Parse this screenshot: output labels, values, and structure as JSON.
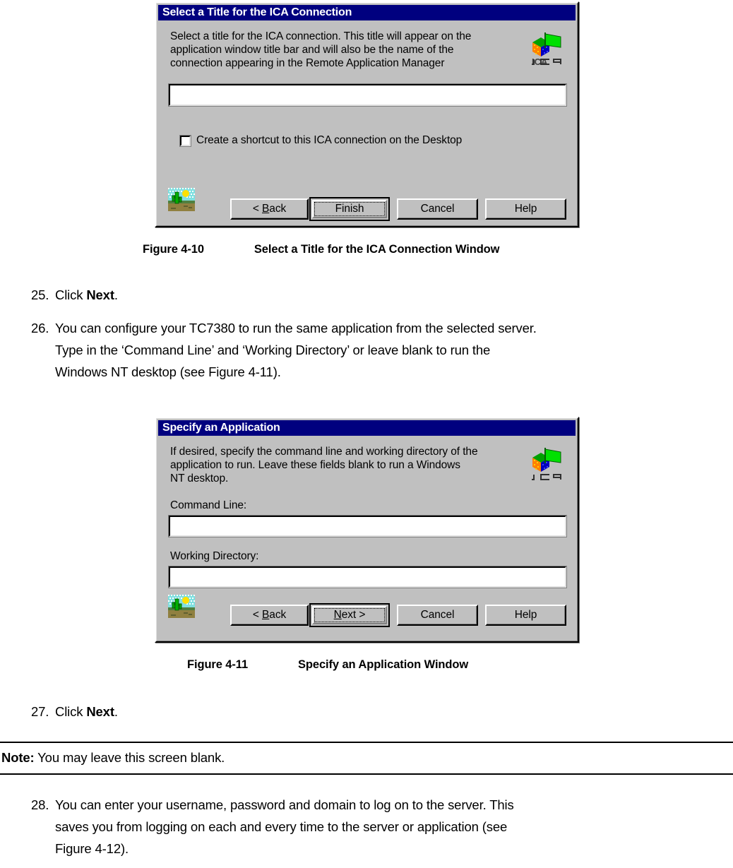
{
  "page": {
    "background": "#ffffff",
    "text_color": "#000000"
  },
  "dialog1": {
    "title": "Select a Title for the ICA Connection",
    "instruction": "Select a title for the ICA connection.  This title will appear on the\napplication window title bar and will also be the name of the\nconnection appearing in the Remote Application Manager",
    "title_input": {
      "value": "",
      "placeholder": ""
    },
    "checkbox": {
      "label": "Create a shortcut to this ICA connection on the Desktop",
      "checked": false
    },
    "buttons": {
      "back": "< Back",
      "finish": "Finish",
      "cancel": "Cancel",
      "help": "Help",
      "default_button": "Finish"
    },
    "titlebar_color": "#00007f",
    "face_color": "#c0c0c0",
    "icons": {
      "logo": "ica-logo-icon",
      "logo_text": "ICA",
      "wizard": "cactus-desert-icon"
    }
  },
  "figure1": {
    "number": "Figure 4-10",
    "caption": "Select a Title for the ICA Connection Window"
  },
  "steps_upper": [
    {
      "number": "25.",
      "text_before": "Click ",
      "text_bold": "Next",
      "text_after": "."
    },
    {
      "number": "26.",
      "text": "You can configure your TC7380 to run the same application from the selected server.\nType in the ‘Command Line’ and ‘Working Directory’ or leave blank to run the\nWindows NT desktop (see Figure 4-11)."
    }
  ],
  "dialog2": {
    "title": "Specify an Application",
    "instruction": "If desired, specify the command line and working directory of the\napplication to run.  Leave these fields blank to run a Windows\nNT desktop.",
    "command_line": {
      "label": "Command Line:",
      "value": "",
      "placeholder": ""
    },
    "working_directory": {
      "label": "Working Directory:",
      "value": "",
      "placeholder": ""
    },
    "buttons": {
      "back": "< Back",
      "next": "Next >",
      "cancel": "Cancel",
      "help": "Help",
      "default_button": "Next >"
    },
    "titlebar_color": "#00007f",
    "face_color": "#c0c0c0",
    "icons": {
      "logo": "ica-logo-icon",
      "logo_text": "ICA",
      "wizard": "cactus-desert-icon"
    }
  },
  "figure2": {
    "number": "Figure 4-11",
    "caption": "Specify an Application Window"
  },
  "step27": {
    "number": "27.",
    "text_before": "Click ",
    "text_bold": "Next",
    "text_after": "."
  },
  "note": {
    "label": "Note:",
    "text": " You may leave this screen blank."
  },
  "step28": {
    "number": "28.",
    "text": "You can enter your username, password and domain to log on to the server.    This\nsaves you from logging on each and every time to the server or application (see\nFigure 4-12)."
  }
}
